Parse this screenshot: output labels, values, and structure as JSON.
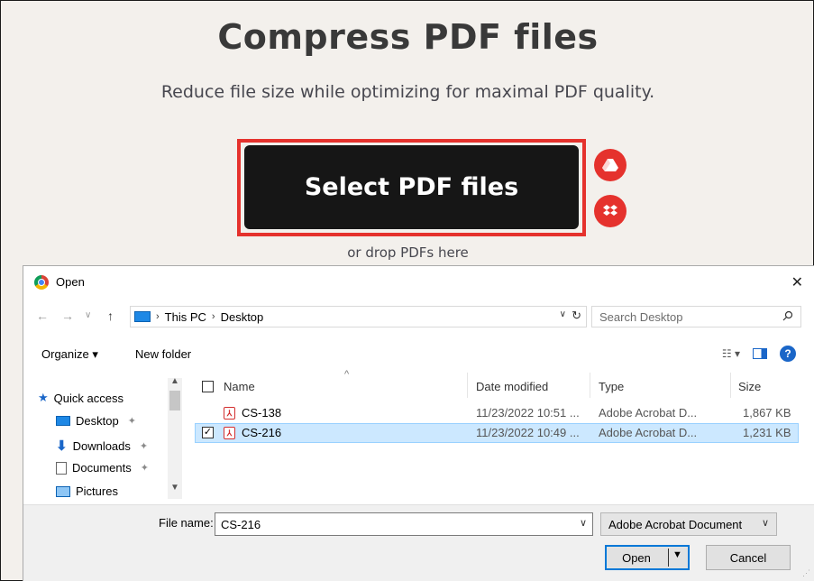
{
  "page": {
    "title": "Compress PDF files",
    "subtitle": "Reduce file size while optimizing for maximal PDF quality.",
    "select_button": "Select PDF files",
    "drop_hint": "or drop PDFs here",
    "cloud_buttons": [
      {
        "name": "google-drive-icon"
      },
      {
        "name": "dropbox-icon"
      }
    ],
    "colors": {
      "accent": "#e5322d",
      "button_bg": "#161616",
      "page_bg": "#f3f0ec"
    }
  },
  "dialog": {
    "title": "Open",
    "close_icon": "✕",
    "breadcrumb": [
      "This PC",
      "Desktop"
    ],
    "search_placeholder": "Search Desktop",
    "toolbar": {
      "organize": "Organize ▾",
      "new_folder": "New folder"
    },
    "nav_items": [
      {
        "label": "Quick access",
        "icon": "star-icon"
      },
      {
        "label": "Desktop",
        "icon": "desktop-icon"
      },
      {
        "label": "Downloads",
        "icon": "download-icon"
      },
      {
        "label": "Documents",
        "icon": "documents-icon"
      },
      {
        "label": "Pictures",
        "icon": "pictures-icon"
      }
    ],
    "columns": [
      "Name",
      "Date modified",
      "Type",
      "Size"
    ],
    "files": [
      {
        "name": "CS-138",
        "date": "11/23/2022 10:51 ...",
        "type": "Adobe Acrobat D...",
        "size": "1,867 KB",
        "selected": false
      },
      {
        "name": "CS-216",
        "date": "11/23/2022 10:49 ...",
        "type": "Adobe Acrobat D...",
        "size": "1,231 KB",
        "selected": true
      }
    ],
    "file_name_label": "File name:",
    "file_name_value": "CS-216",
    "file_type_value": "Adobe Acrobat Document",
    "open_button": "Open",
    "cancel_button": "Cancel"
  }
}
